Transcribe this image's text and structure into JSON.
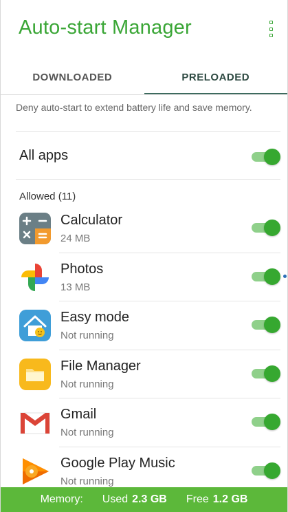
{
  "header": {
    "title": "Auto-start Manager",
    "menu_icon": "more-vertical-icon"
  },
  "tabs": [
    {
      "label": "DOWNLOADED",
      "selected": false
    },
    {
      "label": "PRELOADED",
      "selected": true
    }
  ],
  "description": "Deny auto-start to extend battery life and save memory.",
  "all_apps": {
    "label": "All apps",
    "enabled": true
  },
  "section": {
    "label": "Allowed (11)"
  },
  "apps": [
    {
      "name": "Calculator",
      "subtitle": "24 MB",
      "icon": "calculator-icon",
      "enabled": true
    },
    {
      "name": "Photos",
      "subtitle": "13 MB",
      "icon": "photos-pinwheel-icon",
      "enabled": true
    },
    {
      "name": "Easy mode",
      "subtitle": "Not running",
      "icon": "easy-mode-house-icon",
      "enabled": true
    },
    {
      "name": "File Manager",
      "subtitle": "Not running",
      "icon": "folder-icon",
      "enabled": true
    },
    {
      "name": "Gmail",
      "subtitle": "Not running",
      "icon": "gmail-icon",
      "enabled": true
    },
    {
      "name": "Google Play Music",
      "subtitle": "Not running",
      "icon": "play-music-icon",
      "enabled": true
    }
  ],
  "memory": {
    "label": "Memory:",
    "used_label": "Used",
    "used_value": "2.3 GB",
    "free_label": "Free",
    "free_value": "1.2 GB"
  },
  "colors": {
    "accent": "#3aa636",
    "toggle_on": "#36a830",
    "memory_bar": "#5cb83a"
  }
}
